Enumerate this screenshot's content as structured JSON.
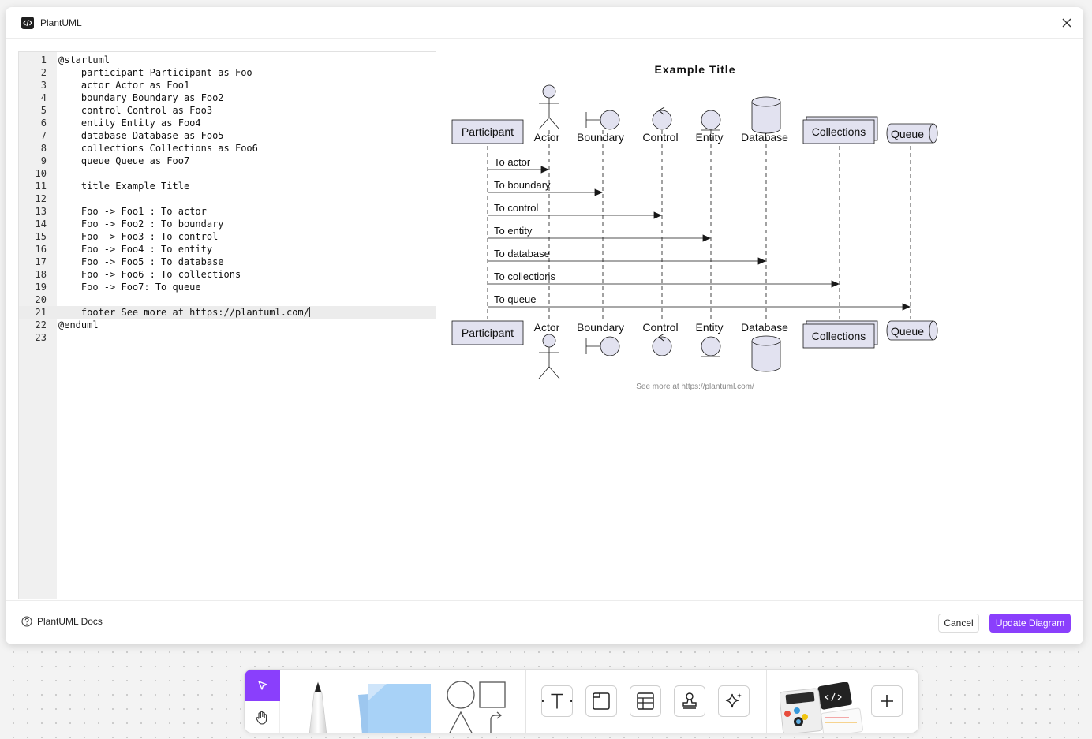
{
  "modal": {
    "title": "PlantUML",
    "footer": {
      "docs_label": "PlantUML Docs",
      "cancel_label": "Cancel",
      "update_label": "Update Diagram"
    }
  },
  "editor": {
    "active_line": 21,
    "lines": [
      {
        "n": "1",
        "t": "@startuml"
      },
      {
        "n": "2",
        "t": "    participant Participant as Foo"
      },
      {
        "n": "3",
        "t": "    actor Actor as Foo1"
      },
      {
        "n": "4",
        "t": "    boundary Boundary as Foo2"
      },
      {
        "n": "5",
        "t": "    control Control as Foo3"
      },
      {
        "n": "6",
        "t": "    entity Entity as Foo4"
      },
      {
        "n": "7",
        "t": "    database Database as Foo5"
      },
      {
        "n": "8",
        "t": "    collections Collections as Foo6"
      },
      {
        "n": "9",
        "t": "    queue Queue as Foo7"
      },
      {
        "n": "10",
        "t": ""
      },
      {
        "n": "11",
        "t": "    title Example Title"
      },
      {
        "n": "12",
        "t": ""
      },
      {
        "n": "13",
        "t": "    Foo -> Foo1 : To actor"
      },
      {
        "n": "14",
        "t": "    Foo -> Foo2 : To boundary"
      },
      {
        "n": "15",
        "t": "    Foo -> Foo3 : To control"
      },
      {
        "n": "16",
        "t": "    Foo -> Foo4 : To entity"
      },
      {
        "n": "17",
        "t": "    Foo -> Foo5 : To database"
      },
      {
        "n": "18",
        "t": "    Foo -> Foo6 : To collections"
      },
      {
        "n": "19",
        "t": "    Foo -> Foo7: To queue"
      },
      {
        "n": "20",
        "t": ""
      },
      {
        "n": "21",
        "t": "    footer See more at https://plantuml.com/"
      },
      {
        "n": "22",
        "t": "@enduml"
      },
      {
        "n": "23",
        "t": ""
      }
    ]
  },
  "diagram": {
    "title": "Example Title",
    "footer": "See more at https://plantuml.com/",
    "participants": {
      "participant": "Participant",
      "actor": "Actor",
      "boundary": "Boundary",
      "control": "Control",
      "entity": "Entity",
      "database": "Database",
      "collections": "Collections",
      "queue": "Queue"
    },
    "messages": [
      "To actor",
      "To boundary",
      "To control",
      "To entity",
      "To database",
      "To collections",
      "To queue"
    ]
  },
  "colors": {
    "accent": "#8a3ffc",
    "participant_fill": "#e2e2f0",
    "participant_stroke": "#181818"
  },
  "toolbar": {
    "tools": [
      "select-icon",
      "hand-icon",
      "pen-icon",
      "sticky-note-icon",
      "shapes-icon",
      "text-icon",
      "frame-icon",
      "table-icon",
      "stamp-icon",
      "ai-sparkle-icon",
      "templates-icon",
      "add-icon"
    ]
  }
}
